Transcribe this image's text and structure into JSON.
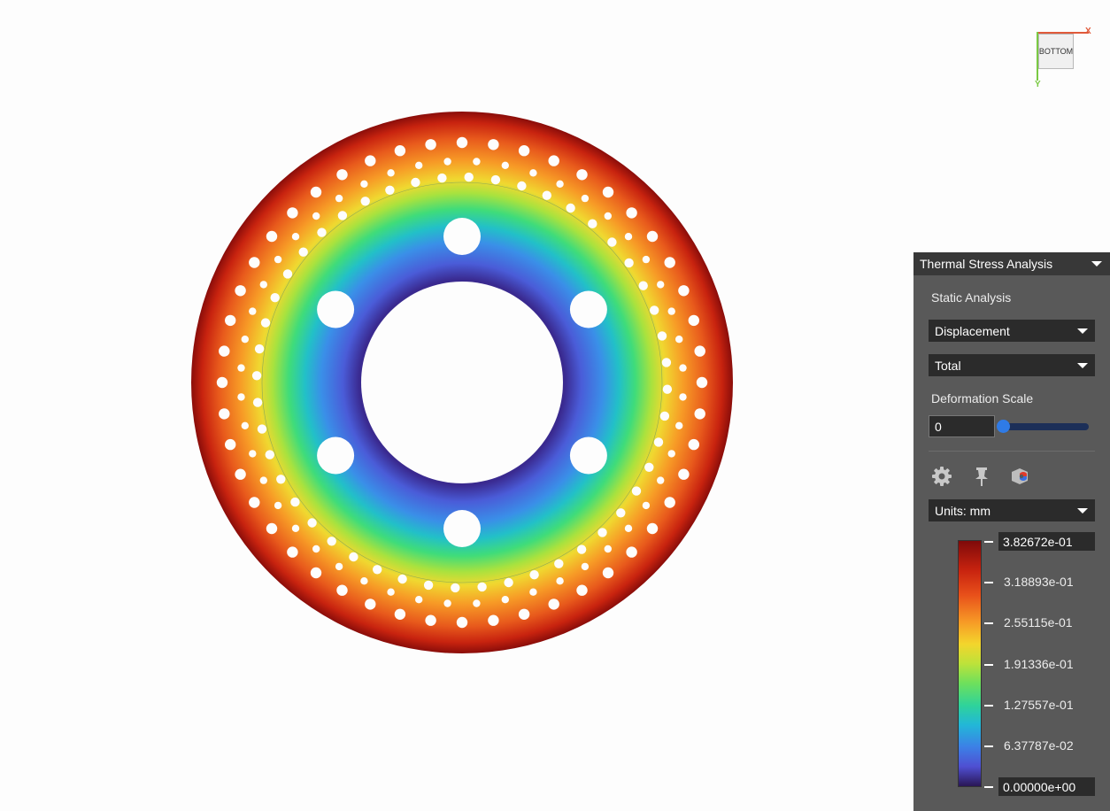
{
  "panel": {
    "title": "Thermal Stress Analysis",
    "analysis_type": "Static Analysis",
    "result_dropdown": "Displacement",
    "component_dropdown": "Total",
    "deformation_label": "Deformation Scale",
    "deformation_value": "0",
    "deformation_slider_fraction": 0,
    "units_dropdown": "Units: mm",
    "tools": [
      "gear-icon",
      "pin-icon",
      "magnet-icon"
    ]
  },
  "legend": {
    "max": "3.82672e-01",
    "labels": [
      "3.18893e-01",
      "2.55115e-01",
      "1.91336e-01",
      "1.27557e-01",
      "6.37787e-02"
    ],
    "min": "0.00000e+00"
  },
  "viewcube": {
    "face": "BOTTOM",
    "x_label": "X",
    "y_label": "Y"
  },
  "colors": {
    "panel_bg": "#595959",
    "panel_header": "#383838",
    "accent_slider": "#2f7be6",
    "map_low": "#2a1655",
    "map_high": "#7f0a0a"
  }
}
